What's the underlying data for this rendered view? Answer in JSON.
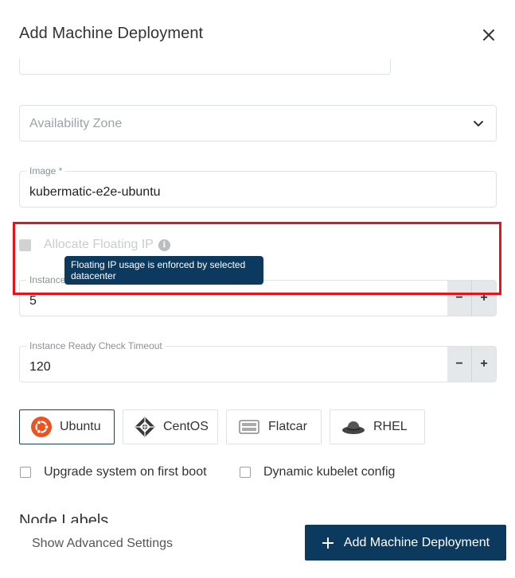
{
  "dialog": {
    "title": "Add Machine Deployment"
  },
  "availability_zone": {
    "placeholder": "Availability Zone"
  },
  "image": {
    "label": "Image *",
    "value": "kubermatic-e2e-ubuntu"
  },
  "floating_ip": {
    "label": "Allocate Floating IP",
    "checked": true,
    "disabled": true,
    "tooltip": "Floating IP usage is enforced by selected datacenter"
  },
  "instance_field": {
    "label": "Instance",
    "value": "5",
    "minus": "−",
    "plus": "+"
  },
  "ready_check": {
    "label": "Instance Ready Check Timeout",
    "value": "120",
    "minus": "−",
    "plus": "+"
  },
  "os_options": [
    {
      "label": "Ubuntu",
      "icon": "ubuntu-icon",
      "selected": true
    },
    {
      "label": "CentOS",
      "icon": "centos-icon",
      "selected": false
    },
    {
      "label": "Flatcar",
      "icon": "flatcar-icon",
      "selected": false
    },
    {
      "label": "RHEL",
      "icon": "rhel-icon",
      "selected": false
    }
  ],
  "checkboxes": [
    {
      "label": "Upgrade system on first boot",
      "checked": false
    },
    {
      "label": "Dynamic kubelet config",
      "checked": false
    }
  ],
  "section": {
    "node_labels": "Node Labels"
  },
  "footer": {
    "advanced": "Show Advanced Settings",
    "submit": "Add Machine Deployment"
  },
  "colors": {
    "primary": "#0c3a5e",
    "highlight": "#e4141c",
    "ubuntu": "#e95420"
  }
}
